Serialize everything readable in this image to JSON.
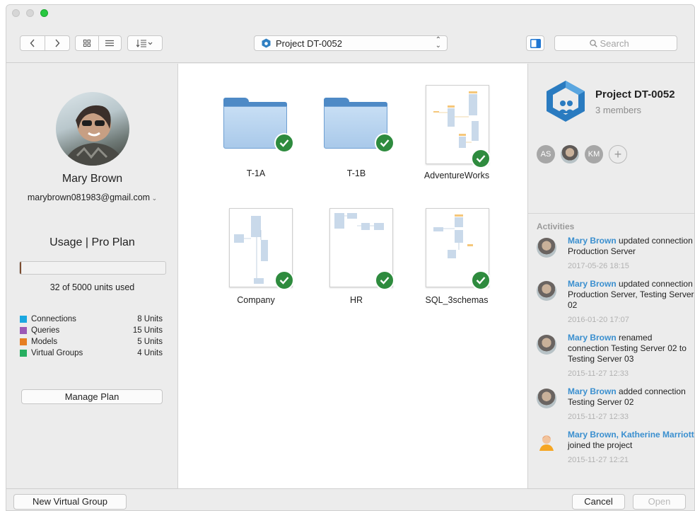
{
  "window": {
    "title": ""
  },
  "toolbar": {
    "back_icon": "chevron-left-icon",
    "forward_icon": "chevron-right-icon",
    "grid_view_icon": "grid-icon",
    "list_view_icon": "list-icon",
    "sort_icon": "sort-icon",
    "project_select": "Project DT-0052",
    "search_placeholder": "Search"
  },
  "user": {
    "name": "Mary Brown",
    "email": "marybrown081983@gmail.com"
  },
  "usage": {
    "title": "Usage | Pro Plan",
    "used_text": "32 of 5000 units used",
    "used_fraction": 0.0064,
    "legend": [
      {
        "name": "Connections",
        "units": "8 Units",
        "color": "#1aa7e0"
      },
      {
        "name": "Queries",
        "units": "15 Units",
        "color": "#9b59b6"
      },
      {
        "name": "Models",
        "units": "5 Units",
        "color": "#e67e22"
      },
      {
        "name": "Virtual Groups",
        "units": "4 Units",
        "color": "#27ae60"
      }
    ],
    "manage_button": "Manage Plan"
  },
  "items": [
    {
      "label": "T-1A",
      "kind": "folder"
    },
    {
      "label": "T-1B",
      "kind": "folder"
    },
    {
      "label": "AdventureWorks",
      "kind": "diagram"
    },
    {
      "label": "Company",
      "kind": "diagram"
    },
    {
      "label": "HR",
      "kind": "diagram"
    },
    {
      "label": "SQL_3schemas",
      "kind": "diagram"
    }
  ],
  "project": {
    "name": "Project DT-0052",
    "members_text": "3 members",
    "members": [
      "AS",
      "",
      "KM"
    ]
  },
  "activities": {
    "title": "Activities",
    "list": [
      {
        "user": "Mary Brown",
        "text": " updated connection Production Server",
        "time": "2017-05-26 18:15"
      },
      {
        "user": "Mary Brown",
        "text": " updated connection Production Server, Testing Server 02",
        "time": "2016-01-20 17:07"
      },
      {
        "user": "Mary Brown",
        "text": " renamed connection Testing Server 02 to Testing Server 03",
        "time": "2015-11-27 12:33"
      },
      {
        "user": "Mary Brown",
        "text": " added connection Testing Server 02",
        "time": "2015-11-27 12:33"
      },
      {
        "user": "Mary Brown, Katherine Marriott",
        "text": " joined the project",
        "time": "2015-11-27 12:21"
      }
    ]
  },
  "bottom": {
    "new_group": "New Virtual Group",
    "cancel": "Cancel",
    "open": "Open"
  }
}
